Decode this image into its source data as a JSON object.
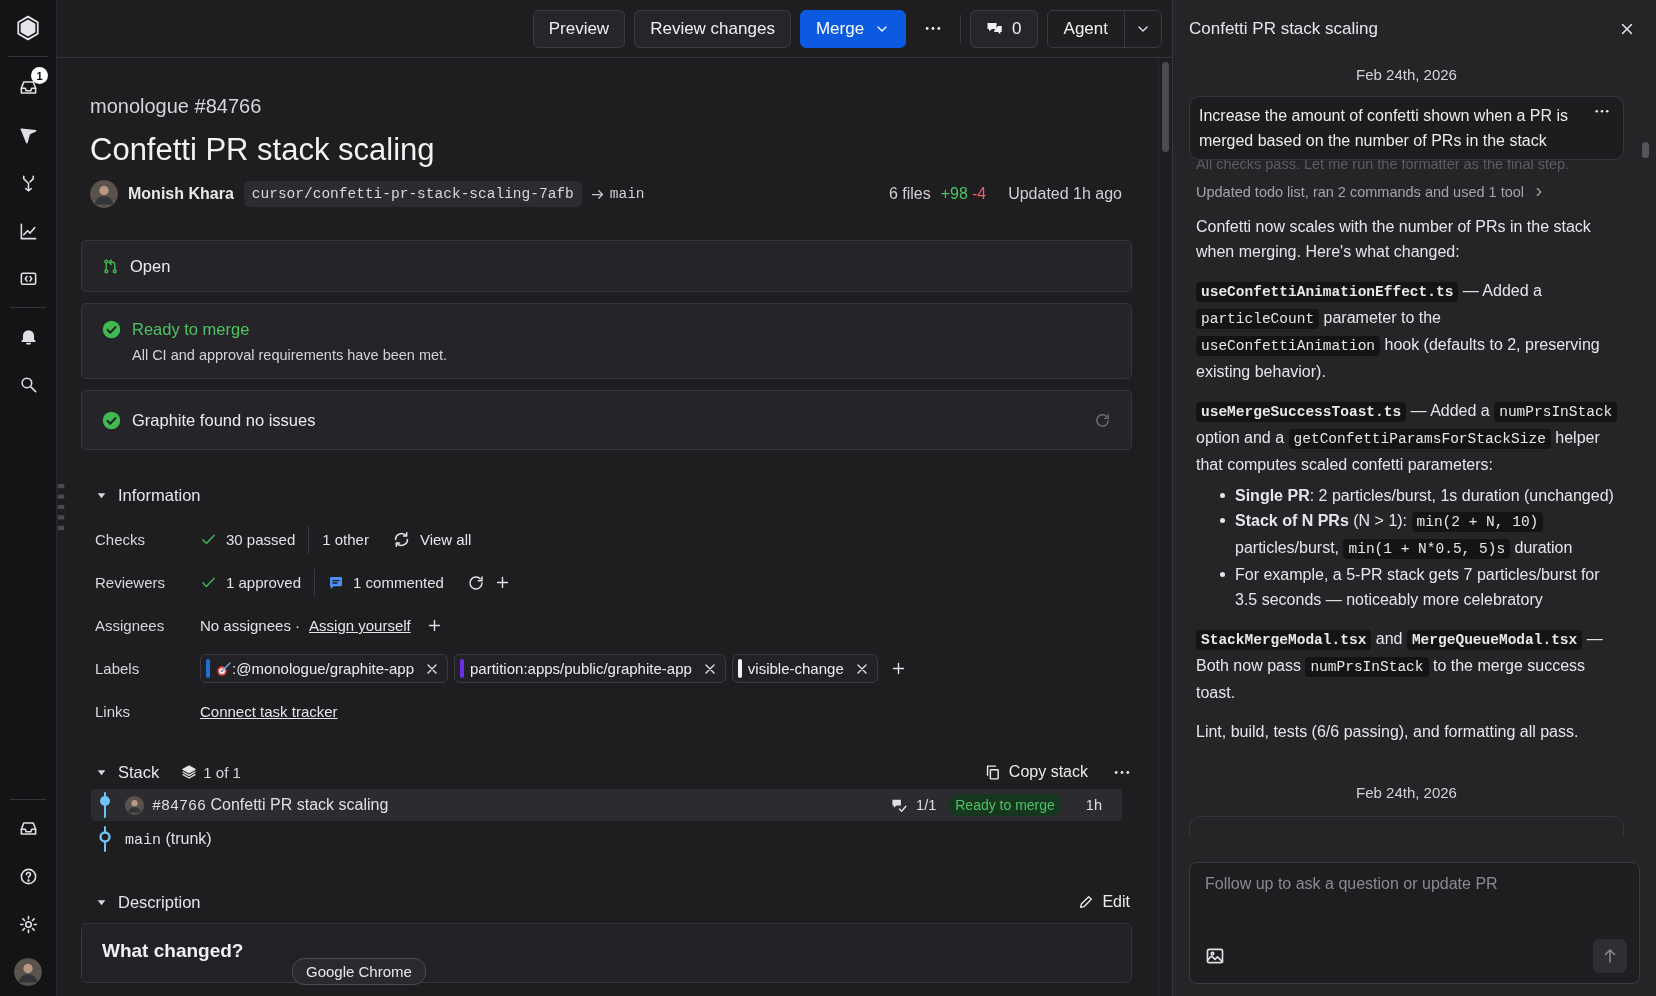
{
  "sidebar": {
    "top": [
      {
        "kind": "inbox",
        "badge": "1"
      },
      {
        "kind": "send"
      },
      {
        "kind": "merge"
      },
      {
        "kind": "chart"
      },
      {
        "kind": "review"
      },
      {
        "kind": "divider"
      },
      {
        "kind": "bell"
      },
      {
        "kind": "search"
      }
    ],
    "bottom": [
      {
        "kind": "inbox"
      },
      {
        "kind": "help"
      },
      {
        "kind": "settings"
      },
      {
        "kind": "avatar"
      }
    ]
  },
  "toolbar": {
    "buttons": [
      {
        "kind": "plain",
        "label": "Preview"
      },
      {
        "kind": "plain",
        "label": "Review changes"
      },
      {
        "kind": "primary",
        "label": "Merge"
      }
    ],
    "comment_count": "0",
    "agent_label": "Agent"
  },
  "pr": {
    "repo_number": "monologue #84766",
    "title": "Confetti PR stack scaling",
    "author": "Monish Khara",
    "branch": "cursor/confetti-pr-stack-scaling-7afb",
    "target": "main",
    "files": "6 files",
    "additions": "+98",
    "deletions": "-4",
    "updated": "Updated 1h ago"
  },
  "status_cards": [
    {
      "kind": "open",
      "title": "Open"
    },
    {
      "kind": "ready",
      "title": "Ready to merge",
      "detail": "All CI and approval requirements have been met."
    },
    {
      "kind": "review",
      "title": "Graphite found no issues"
    }
  ],
  "information": {
    "heading": "Information",
    "expanded": true,
    "checks": {
      "label": "Checks",
      "passed": "30 passed",
      "other": "1 other",
      "link": "View all"
    },
    "reviewers": {
      "label": "Reviewers",
      "approved": "1 approved",
      "commented": "1 commented"
    },
    "assignees": {
      "label": "Assignees",
      "text": "No assignees ·",
      "link": "Assign yourself"
    },
    "labels": {
      "label": "Labels",
      "items": [
        {
          "kind": "emoji",
          "text": ":@monologue/graphite-app",
          "color": "#1f6fd6"
        },
        {
          "kind": "plain",
          "text": "partition:apps/public/graphite-app",
          "color": "#6a2ee8"
        },
        {
          "kind": "plain",
          "text": "visible-change",
          "color": "#f2f2f2"
        }
      ]
    },
    "links": {
      "label": "Links",
      "link": "Connect task tracker"
    }
  },
  "stack": {
    "heading": "Stack",
    "expanded": true,
    "count": "1 of 1",
    "copy_label": "Copy stack",
    "items": [
      {
        "kind": "pr",
        "number": "#84766",
        "title": "Confetti PR stack scaling",
        "comments": "1/1",
        "status": "Ready to merge",
        "age": "1h",
        "selected": true
      },
      {
        "kind": "trunk",
        "branch": "main",
        "note": "(trunk)",
        "selected": false
      }
    ]
  },
  "description": {
    "heading": "Description",
    "expanded": true,
    "edit_label": "Edit",
    "body_heading": "What changed?",
    "tooltip": "Google Chrome"
  },
  "chat": {
    "title": "Confetti PR stack scaling",
    "date": "Feb 24th, 2026",
    "user_message": "Increase the amount of confetti shown when a PR is merged based on the number of PRs in the stack",
    "faded_line": "All checks pass. Let me run the formatter as the final step.",
    "activity": "Updated todo list, ran 2 commands and used 1 tool",
    "blocks": [
      {
        "kind": "paragraph",
        "parts": [
          {
            "kind": "text",
            "text": "Confetti now scales with the number of PRs in the stack when merging. Here's what changed:"
          }
        ]
      },
      {
        "kind": "paragraph",
        "parts": [
          {
            "kind": "code",
            "strong": true,
            "text": "useConfettiAnimationEffect.ts"
          },
          {
            "kind": "text",
            "text": " — Added a "
          },
          {
            "kind": "code",
            "strong": false,
            "text": "particleCount"
          },
          {
            "kind": "text",
            "text": " parameter to the "
          },
          {
            "kind": "code",
            "strong": false,
            "text": "useConfettiAnimation"
          },
          {
            "kind": "text",
            "text": " hook (defaults to 2, preserving existing behavior)."
          }
        ]
      },
      {
        "kind": "paragraph",
        "parts": [
          {
            "kind": "code",
            "strong": true,
            "text": "useMergeSuccessToast.ts"
          },
          {
            "kind": "text",
            "text": " — Added a "
          },
          {
            "kind": "code",
            "strong": false,
            "text": "numPrsInStack"
          },
          {
            "kind": "text",
            "text": " option and a "
          },
          {
            "kind": "code",
            "strong": false,
            "text": "getConfettiParamsForStackSize"
          },
          {
            "kind": "text",
            "text": " helper that computes scaled confetti parameters:"
          }
        ]
      },
      {
        "kind": "list",
        "items": [
          {
            "parts": [
              {
                "kind": "text",
                "text": "**Single PR**: 2 particles/burst, 1s duration (unchanged)"
              }
            ]
          },
          {
            "parts": [
              {
                "kind": "text",
                "text": "**Stack of N PRs** (N > 1): "
              },
              {
                "kind": "code",
                "strong": false,
                "text": "min(2 + N, 10)"
              },
              {
                "kind": "text",
                "text": " particles/burst, "
              },
              {
                "kind": "code",
                "strong": false,
                "text": "min(1 + N*0.5, 5)s"
              },
              {
                "kind": "text",
                "text": " duration"
              }
            ]
          },
          {
            "parts": [
              {
                "kind": "text",
                "text": "For example, a 5-PR stack gets 7 particles/burst for 3.5 seconds — noticeably more celebratory"
              }
            ]
          }
        ]
      },
      {
        "kind": "paragraph",
        "parts": [
          {
            "kind": "code",
            "strong": true,
            "text": "StackMergeModal.tsx"
          },
          {
            "kind": "text",
            "text": " and "
          },
          {
            "kind": "code",
            "strong": true,
            "text": "MergeQueueModal.tsx"
          },
          {
            "kind": "text",
            "text": " — Both now pass "
          },
          {
            "kind": "code",
            "strong": false,
            "text": "numPrsInStack"
          },
          {
            "kind": "text",
            "text": " to the merge success toast."
          }
        ]
      },
      {
        "kind": "paragraph",
        "parts": [
          {
            "kind": "text",
            "text": "Lint, build, tests (6/6 passing), and formatting all pass."
          }
        ]
      }
    ],
    "date_2": "Feb 24th, 2026",
    "composer": {
      "placeholder": "Follow up to ask a question or update PR"
    }
  }
}
